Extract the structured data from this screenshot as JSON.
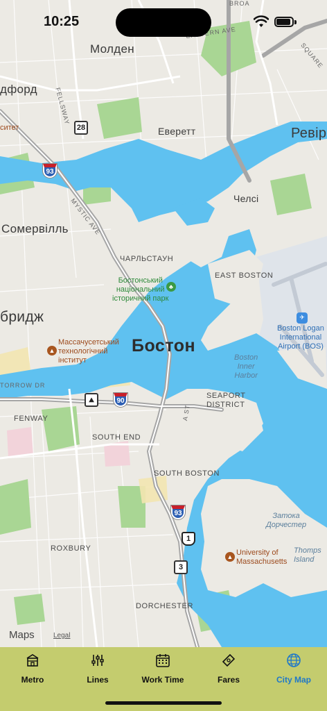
{
  "status_bar": {
    "time": "10:25"
  },
  "map": {
    "labels": {
      "malden": "Молден",
      "medford": "дфорд",
      "everett": "Еверетт",
      "revere": "Ревір",
      "chelsea": "Челсі",
      "somerville": "Сомервілль",
      "cambridge": "бридж",
      "boston": "Бостон",
      "charlestown": "ЧАРЛЬСТАУН",
      "east_boston": "EAST BOSTON",
      "fenway": "FENWAY",
      "south_end": "SOUTH END",
      "south_boston": "SOUTH BOSTON",
      "seaport": "SEAPORT\nDISTRICT",
      "roxbury": "ROXBURY",
      "dorchester": "DORCHESTER",
      "thompson_island": "Thomps\nIsland",
      "univ_fragment": "ситет",
      "national_park": "Бостонський\nнаціональний\nісторичний парк",
      "mit": "Массачусетський\nтехнологічний\nінститут",
      "airport": "Boston Logan\nInternational\nAirport (BOS)",
      "inner_harbor": "Boston\nInner\nHarbor",
      "dorchester_bay": "Затока\nДорчестер",
      "umass": "University of\nMassachusetts",
      "eastern_ave": "EASTERN AVE",
      "fellsway": "FELLSWAY",
      "mystic_ave": "MYSTIC AVE",
      "storrow_dr": "TORROW DR",
      "a_st": "A ST",
      "broadway": "BROA",
      "square": "SQUARE"
    },
    "shields": {
      "i93_north": "93",
      "i93_south": "93",
      "i90": "90",
      "route28": "28",
      "route1": "1",
      "route3": "3"
    },
    "attribution": {
      "brand": "Maps",
      "legal": "Legal"
    }
  },
  "tabs": [
    {
      "label": "Metro",
      "icon": "building-icon",
      "active": false
    },
    {
      "label": "Lines",
      "icon": "sliders-icon",
      "active": false
    },
    {
      "label": "Work Time",
      "icon": "calendar-icon",
      "active": false
    },
    {
      "label": "Fares",
      "icon": "ticket-icon",
      "active": false
    },
    {
      "label": "City Map",
      "icon": "globe-icon",
      "active": true
    }
  ],
  "colors": {
    "tab_bar": "#c4cc6e",
    "active_tab": "#1f78c8",
    "water": "#5fc1f0",
    "park": "#9fd38c",
    "land": "#eceae4"
  }
}
